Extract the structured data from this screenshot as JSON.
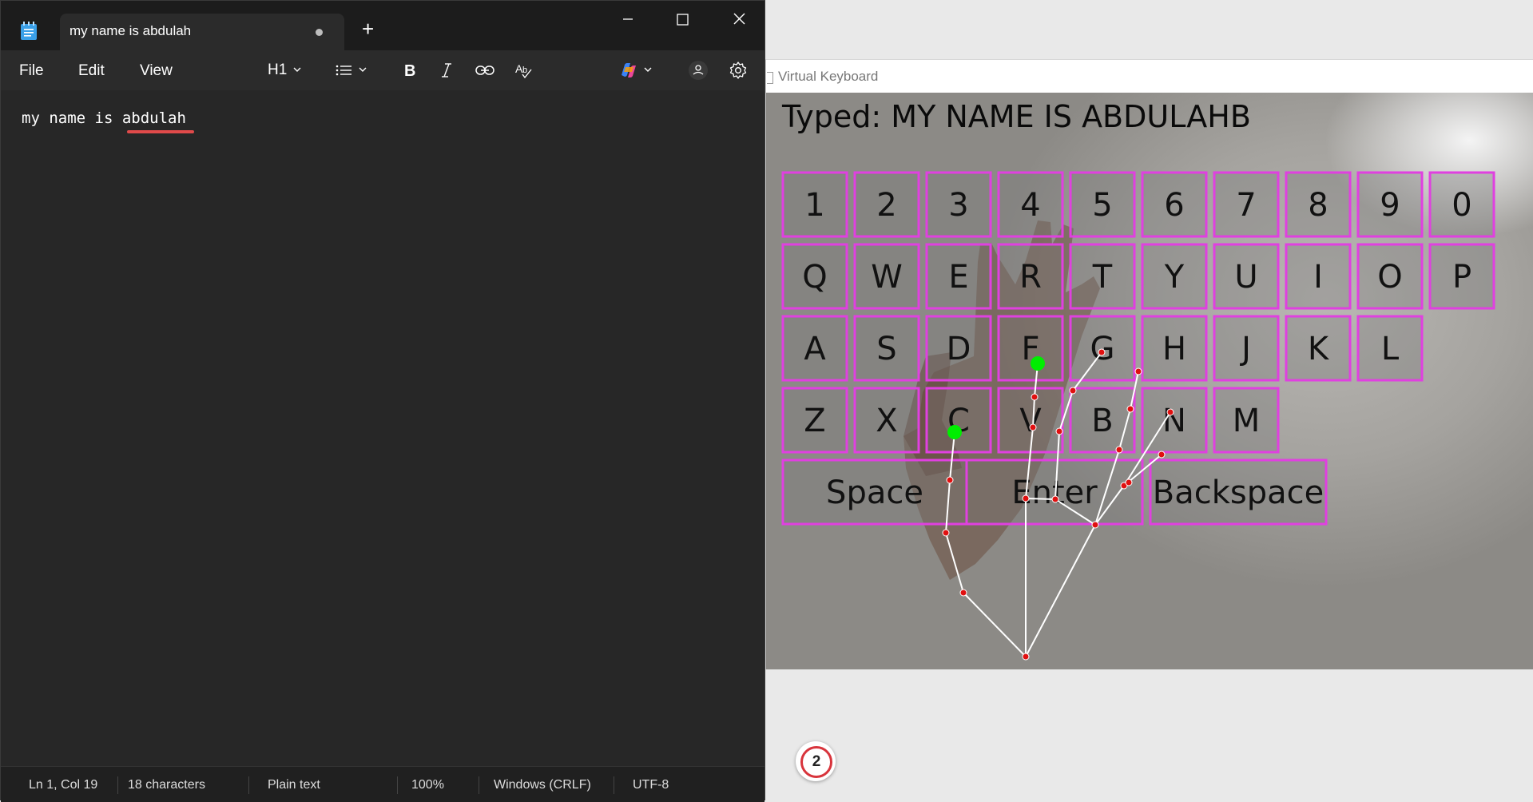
{
  "notepad": {
    "tab_title": "my name is abdulah",
    "new_tab_symbol": "+",
    "menu": {
      "file": "File",
      "edit": "Edit",
      "view": "View"
    },
    "toolbar": {
      "heading": "H1"
    },
    "content": "my name is abdulah",
    "status": {
      "position": "Ln 1, Col 19",
      "characters": "18 characters",
      "format": "Plain text",
      "zoom": "100%",
      "line_endings": "Windows (CRLF)",
      "encoding": "UTF-8"
    },
    "icons": [
      "notepad-icon",
      "minimize-icon",
      "maximize-icon",
      "close-icon",
      "list-icon",
      "chevron-down-icon",
      "bold-icon",
      "italic-icon",
      "link-icon",
      "spellcheck-icon",
      "copilot-icon",
      "account-icon",
      "gear-icon"
    ]
  },
  "virtual_keyboard": {
    "window_title": "Virtual Keyboard",
    "typed_text": "Typed: MY NAME IS ABDULAHB",
    "key_rows": [
      [
        "1",
        "2",
        "3",
        "4",
        "5",
        "6",
        "7",
        "8",
        "9",
        "0"
      ],
      [
        "Q",
        "W",
        "E",
        "R",
        "T",
        "Y",
        "U",
        "I",
        "O",
        "P"
      ],
      [
        "A",
        "S",
        "D",
        "F",
        "G",
        "H",
        "J",
        "K",
        "L"
      ],
      [
        "Z",
        "X",
        "C",
        "V",
        "B",
        "N",
        "M"
      ]
    ],
    "special_keys": [
      "Space",
      "Enter",
      "Backspace"
    ],
    "colors": {
      "key_border": "#e040e0",
      "landmark": "#e01010",
      "fingertip": "#00ee00",
      "skeleton": "#ffffff"
    }
  },
  "taskbar_badge": {
    "count": "2",
    "ring_color": "#d8343c"
  }
}
